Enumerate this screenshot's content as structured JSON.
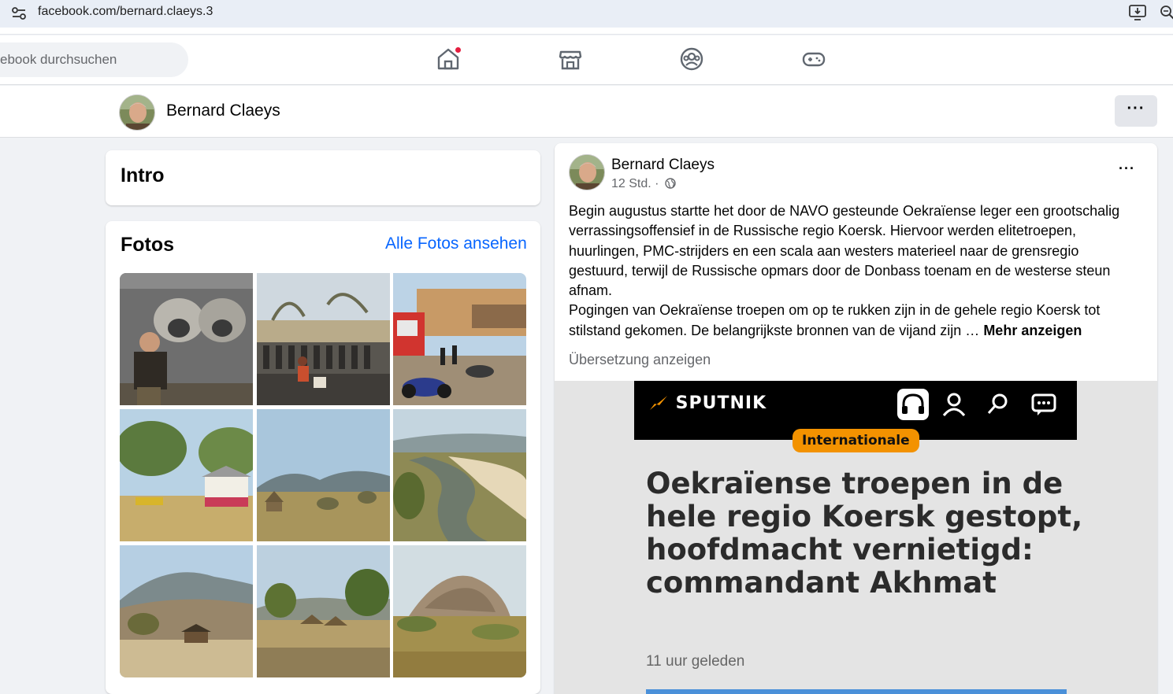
{
  "browser": {
    "url": "facebook.com/bernard.claeys.3",
    "icons": [
      "site-settings-icon",
      "install-app-icon",
      "zoom-icon"
    ]
  },
  "nav": {
    "search_placeholder": "ebook durchsuchen",
    "items": [
      "home-icon",
      "marketplace-icon",
      "groups-icon",
      "gaming-icon"
    ],
    "home_has_notification": true
  },
  "profile_header": {
    "name": "Bernard Claeys",
    "more_label": "···"
  },
  "intro": {
    "title": "Intro"
  },
  "photos": {
    "title": "Fotos",
    "see_all": "Alle Fotos ansehen",
    "count": 9
  },
  "post": {
    "author": "Bernard Claeys",
    "time": "12 Std. ·",
    "more_label": "···",
    "paragraph1": "Begin augustus startte het door de NAVO gesteunde Oekraïense leger een grootschalig verrassingsoffensief in de Russische regio Koersk. Hiervoor werden elitetroepen, huurlingen, PMC-strijders en een scala aan westers materieel naar de grensregio gestuurd, terwijl de Russische opmars door de Donbass toenam en de westerse steun afnam.",
    "paragraph2": "Pogingen van Oekraïense troepen om op te rukken zijn in de gehele regio Koersk tot stilstand gekomen. De belangrijkste bronnen van de vijand zijn …",
    "see_more": "Mehr anzeigen",
    "translate": "Übersetzung anzeigen"
  },
  "preview": {
    "brand": "SPUTNIK",
    "badge": "Internationale",
    "headline": "Oekraïense troepen in de hele regio Koersk gestopt, hoofdmacht vernietigd: commandant Akhmat",
    "time_ago": "11 uur geleden",
    "colors": {
      "badge": "#f39200",
      "bar": "#000000"
    }
  }
}
